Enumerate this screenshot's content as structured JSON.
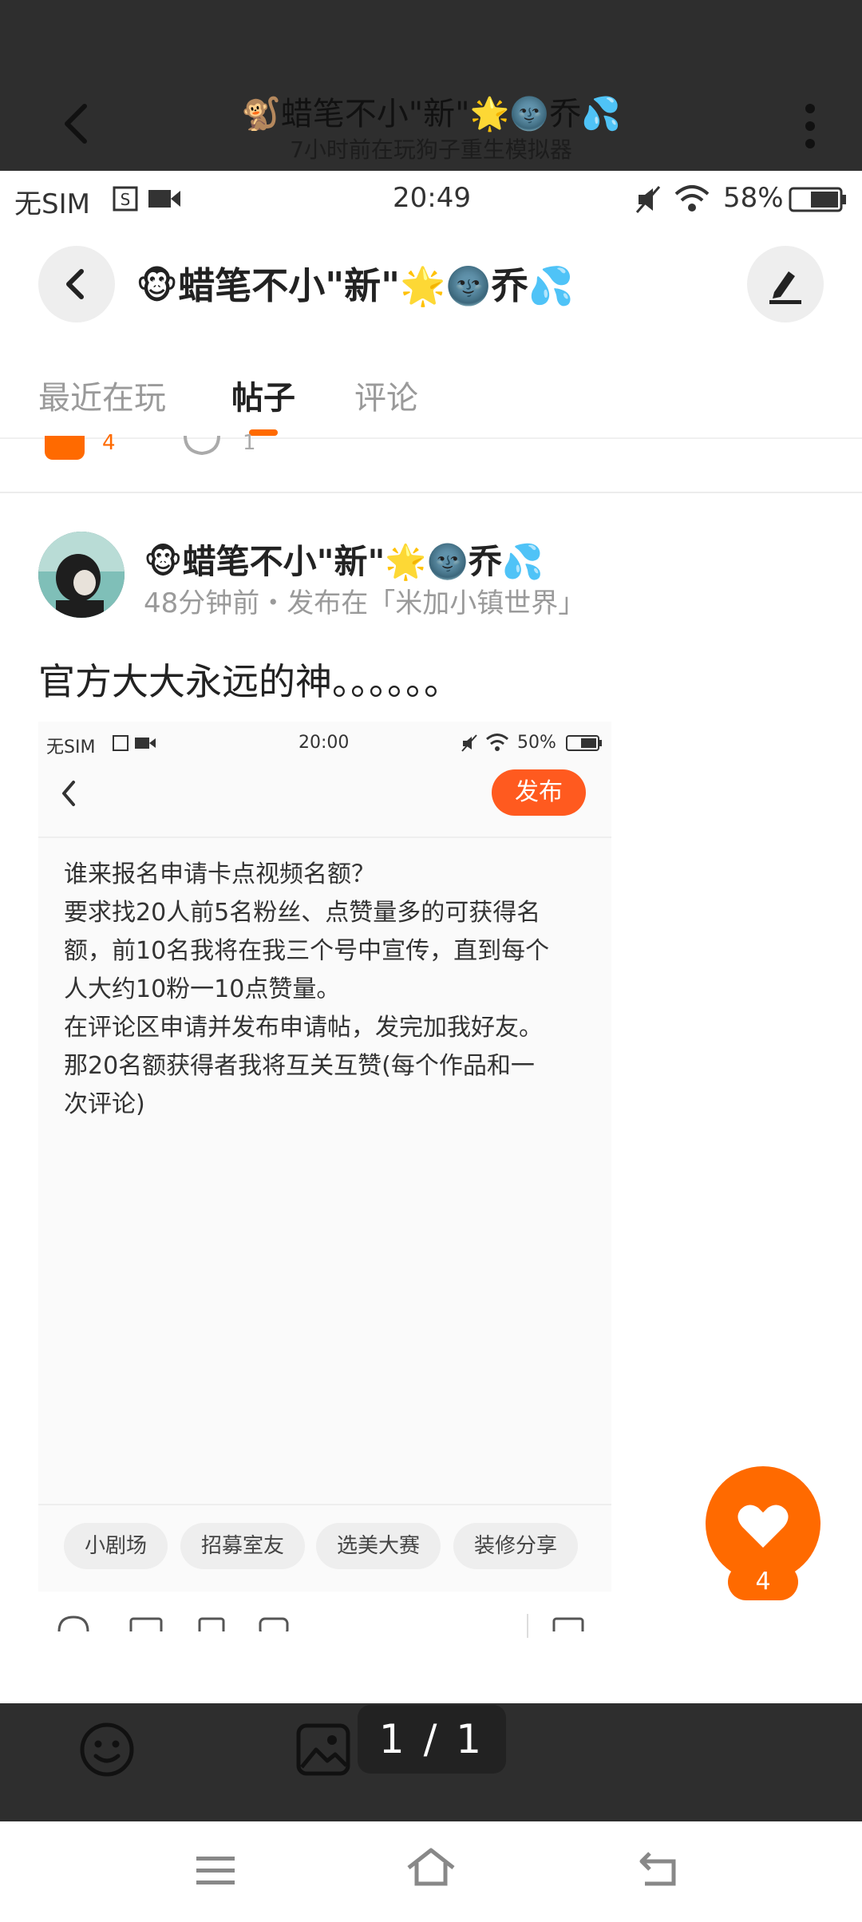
{
  "viewer": {
    "title": "🐒蜡笔不小\"新\"🌟🌚乔💦",
    "subtitle": "7小时前在玩狗子重生模拟器",
    "page_indicator": "1 / 1"
  },
  "status_bar": {
    "carrier": "无SIM",
    "time": "20:49",
    "battery": "58%"
  },
  "header": {
    "title": "🐵蜡笔不小\"新\"🌟🌚乔💦"
  },
  "tabs": [
    {
      "label": "最近在玩",
      "active": false
    },
    {
      "label": "帖子",
      "active": true
    },
    {
      "label": "评论",
      "active": false
    }
  ],
  "previous_post": {
    "like_count": "4",
    "comment_count": "1"
  },
  "post": {
    "author": "🐵蜡笔不小\"新\"🌟🌚乔💦",
    "meta": "48分钟前・发布在「米加小镇世界」",
    "body": "官方大大永远的神。。。。。。",
    "like_count": "4"
  },
  "embedded_screenshot": {
    "carrier": "无SIM",
    "time": "20:00",
    "battery": "50%",
    "publish_label": "发布",
    "text_lines": [
      "谁来报名申请卡点视频名额？",
      "要求找20人前5名粉丝、点赞量多的可获得名",
      "额，前10名我将在我三个号中宣传，直到每个",
      "人大约10粉一10点赞量。",
      "在评论区申请并发布申请帖，发完加我好友。",
      "那20名额获得者我将互关互赞(每个作品和一",
      "次评论)"
    ],
    "tags": [
      "小剧场",
      "招募室友",
      "选美大赛",
      "装修分享"
    ]
  },
  "colors": {
    "accent": "#ff6a00",
    "publish_button": "#ff5a1f",
    "viewer_background": "#2e2e2e"
  }
}
